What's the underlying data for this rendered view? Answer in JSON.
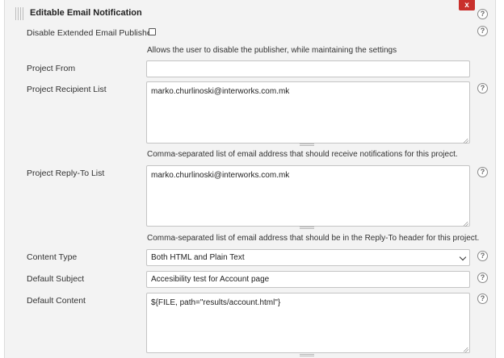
{
  "section": {
    "title": "Editable Email Notification",
    "close_label": "x"
  },
  "help_glyph": "?",
  "fields": {
    "disable_publisher": {
      "label": "Disable Extended Email Publisher",
      "checked": false,
      "description": "Allows the user to disable the publisher, while maintaining the settings"
    },
    "project_from": {
      "label": "Project From",
      "value": ""
    },
    "recipient_list": {
      "label": "Project Recipient List",
      "value": "marko.churlinoski@interworks.com.mk",
      "description": "Comma-separated list of email address that should receive notifications for this project."
    },
    "reply_to_list": {
      "label": "Project Reply-To List",
      "value": "marko.churlinoski@interworks.com.mk",
      "description": "Comma-separated list of email address that should be in the Reply-To header for this project."
    },
    "content_type": {
      "label": "Content Type",
      "selected": "Both HTML and Plain Text"
    },
    "default_subject": {
      "label": "Default Subject",
      "value": "Accesibility test for Account page"
    },
    "default_content": {
      "label": "Default Content",
      "value": "${FILE, path=\"results/account.html\"}"
    }
  },
  "icons": [
    "drag-handle-icon",
    "close-icon",
    "help-icon",
    "chevron-down-icon",
    "resize-handle-icon"
  ],
  "colors": {
    "panel_bg": "#f3f3f3",
    "close_button": "#c9302c"
  }
}
